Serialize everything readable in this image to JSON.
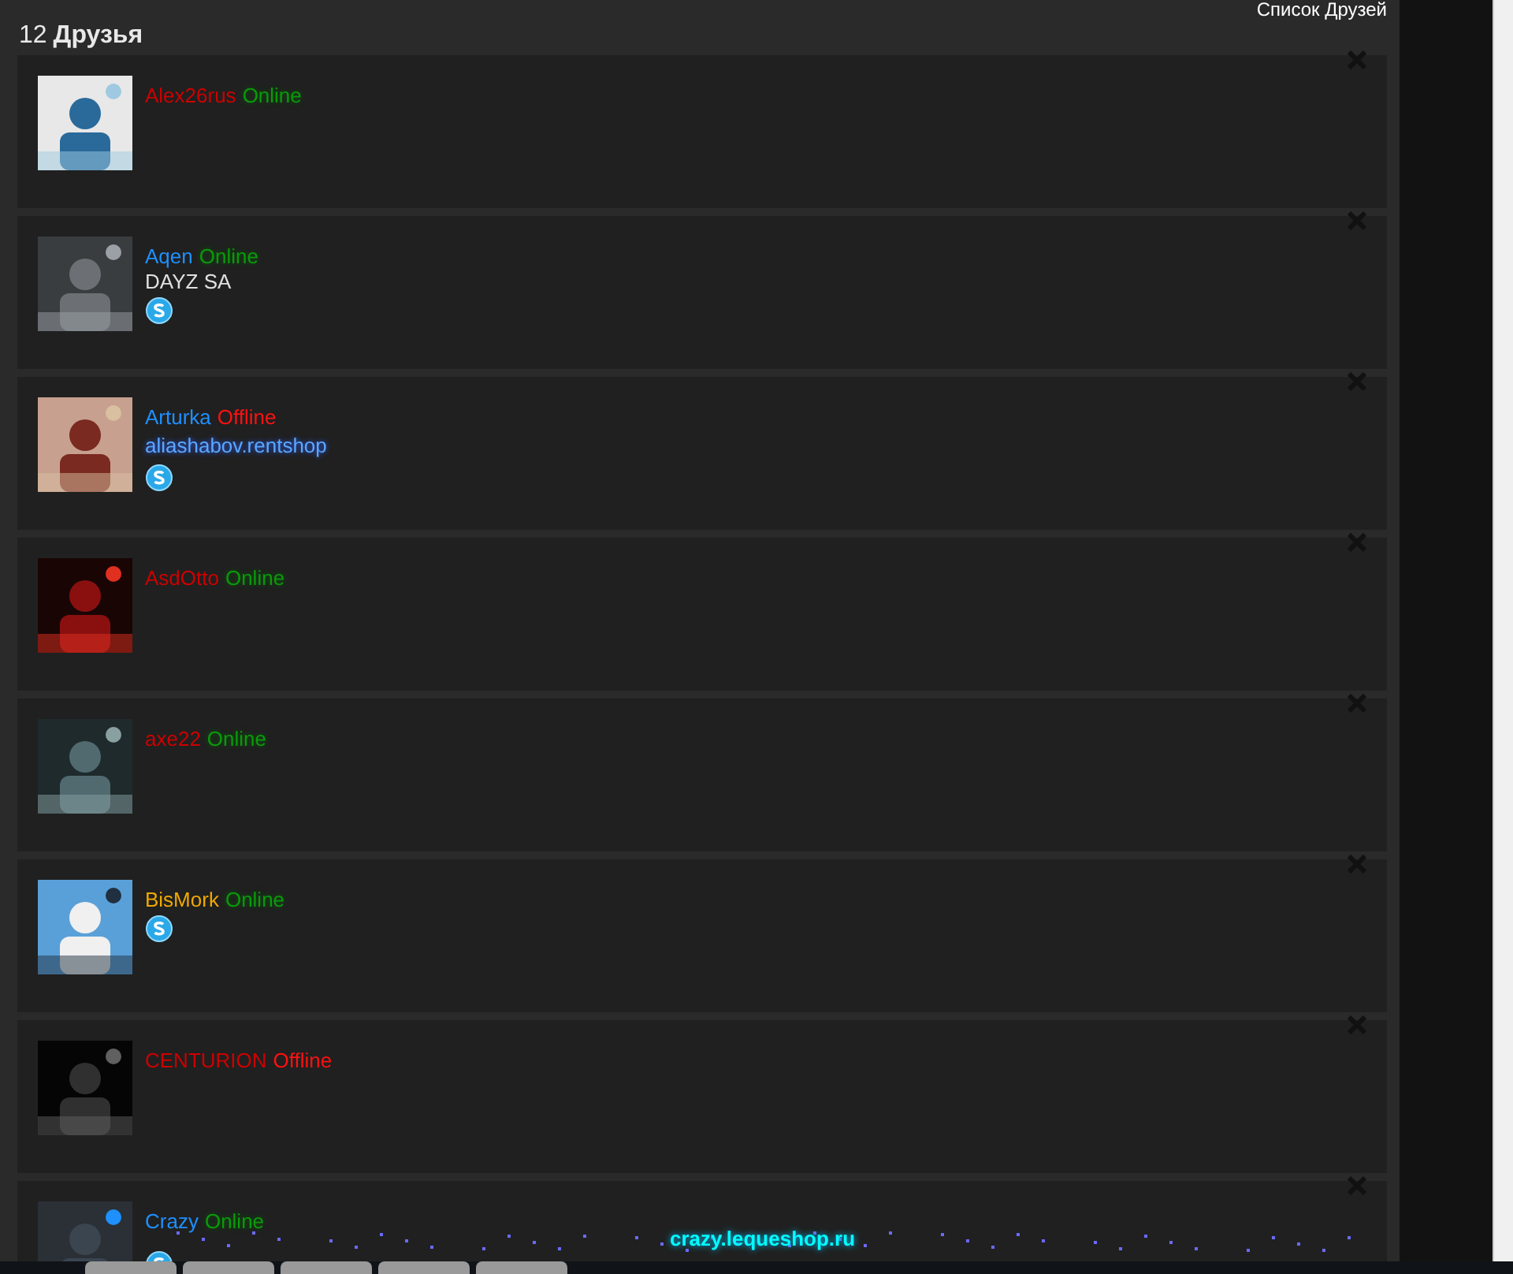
{
  "header": {
    "count": "12",
    "title": "Друзья",
    "link": "Список Друзей"
  },
  "friends": [
    {
      "name": "Alex26rus",
      "color": "#cc0000",
      "status": "Online",
      "online": true
    },
    {
      "name": "Aqen",
      "color": "#1e90ff",
      "status": "Online",
      "online": true,
      "lines": [
        {
          "kind": "text",
          "text": "DAYZ SA"
        },
        {
          "kind": "skype"
        }
      ]
    },
    {
      "name": "Arturka",
      "color": "#1e90ff",
      "status": "Offline",
      "online": false,
      "lines": [
        {
          "kind": "link",
          "text": "aliashabov.rentshop"
        },
        {
          "kind": "skype"
        }
      ]
    },
    {
      "name": "AsdOtto",
      "color": "#cc0000",
      "status": "Online",
      "online": true
    },
    {
      "name": "axe22",
      "color": "#cc0000",
      "status": "Online",
      "online": true
    },
    {
      "name": "BisMork",
      "color": "#f0a800",
      "status": "Online",
      "online": true,
      "lines": [
        {
          "kind": "skype"
        }
      ]
    },
    {
      "name": "CENTURION",
      "color": "#cc0000",
      "status": "Offline",
      "online": false
    },
    {
      "name": "Crazy",
      "color": "#1e90ff",
      "status": "Online",
      "online": true,
      "lines": [
        {
          "kind": "sparkle",
          "text": "crazy.lequeshop.ru"
        },
        {
          "kind": "skype"
        }
      ]
    }
  ]
}
